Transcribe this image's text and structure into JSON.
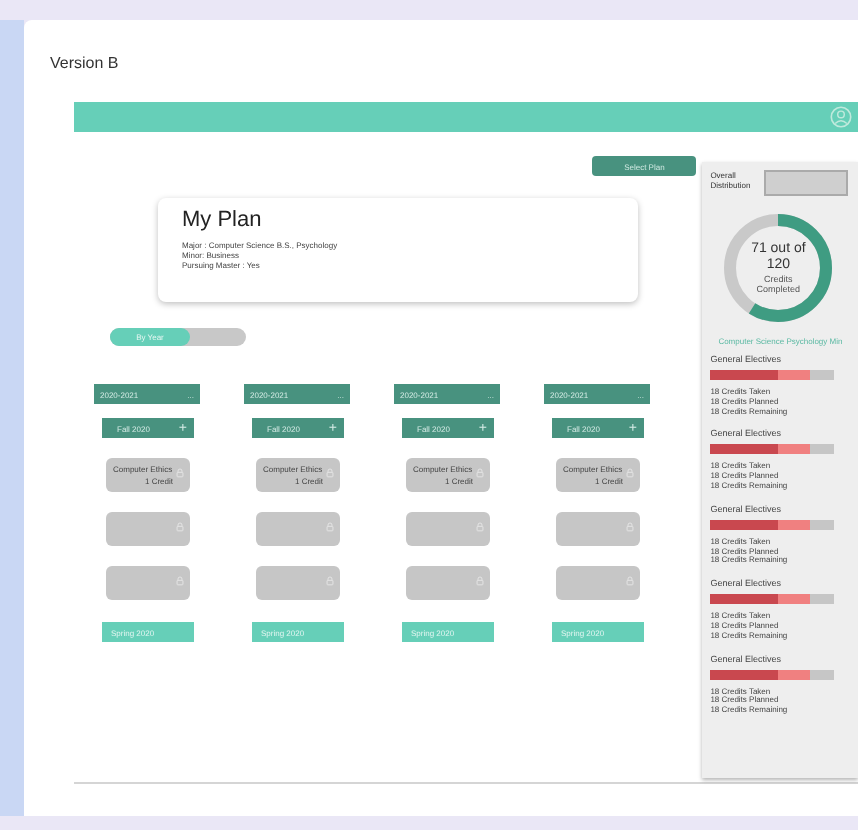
{
  "page_title": "Version B",
  "select_plan_button": "Select Plan",
  "plan_card": {
    "title": "My Plan",
    "lines": [
      "Major : Computer Science B.S., Psychology",
      "Minor: Business",
      "Pursuing Master : Yes"
    ]
  },
  "view_toggle": {
    "label": "By Year",
    "on": true
  },
  "years": [
    {
      "label": "2020-2021",
      "menu": "...",
      "fall": "Fall 2020",
      "add": "+",
      "courses": [
        {
          "kind": "course",
          "name": "Computer Ethics",
          "credits": "1 Credit"
        },
        {
          "kind": "empty"
        },
        {
          "kind": "empty"
        }
      ],
      "spring": "Spring 2020"
    },
    {
      "label": "2020-2021",
      "menu": "...",
      "fall": "Fall 2020",
      "add": "+",
      "courses": [
        {
          "kind": "course",
          "name": "Computer Ethics",
          "credits": "1 Credit"
        },
        {
          "kind": "empty"
        },
        {
          "kind": "empty"
        }
      ],
      "spring": "Spring 2020"
    },
    {
      "label": "2020-2021",
      "menu": "...",
      "fall": "Fall 2020",
      "add": "+",
      "courses": [
        {
          "kind": "course",
          "name": "Computer Ethics",
          "credits": "1 Credit"
        },
        {
          "kind": "empty"
        },
        {
          "kind": "empty"
        }
      ],
      "spring": "Spring 2020"
    },
    {
      "label": "2020-2021",
      "menu": "...",
      "fall": "Fall 2020",
      "add": "+",
      "courses": [
        {
          "kind": "course",
          "name": "Computer Ethics",
          "credits": "1 Credit"
        },
        {
          "kind": "empty"
        },
        {
          "kind": "empty"
        }
      ],
      "spring": "Spring 2020"
    }
  ],
  "distribution": {
    "title": "Overall Distribution",
    "progress": {
      "level": 0.59,
      "lines": [
        "71 out of",
        "120",
        "Credits",
        "Completed"
      ]
    },
    "caption": "Computer Science Psychology Min",
    "categories": [
      {
        "title": "General Electives",
        "taken": {
          "level": 0.55
        },
        "planned": {
          "level": 0.8
        },
        "lines": [
          "18 Credits Taken",
          "18 Credits Planned",
          "18 Credits Remaining"
        ]
      },
      {
        "title": "General Electives",
        "taken": {
          "level": 0.55
        },
        "planned": {
          "level": 0.8
        },
        "lines": [
          "18 Credits Taken",
          "18 Credits Planned",
          "18 Credits Remaining"
        ]
      },
      {
        "title": "General Electives",
        "taken": {
          "level": 0.55
        },
        "planned": {
          "level": 0.8
        },
        "lines": [
          "18 Credits Taken",
          "18 Credits Planned",
          "18 Credits Remaining"
        ]
      },
      {
        "title": "General Electives",
        "taken": {
          "level": 0.55
        },
        "planned": {
          "level": 0.8
        },
        "lines": [
          "18 Credits Taken",
          "18 Credits Planned",
          "18 Credits Remaining"
        ]
      },
      {
        "title": "General Electives",
        "taken": {
          "level": 0.55
        },
        "planned": {
          "level": 0.8
        },
        "lines": [
          "18 Credits Taken",
          "18 Credits Planned",
          "18 Credits Remaining"
        ]
      }
    ]
  }
}
